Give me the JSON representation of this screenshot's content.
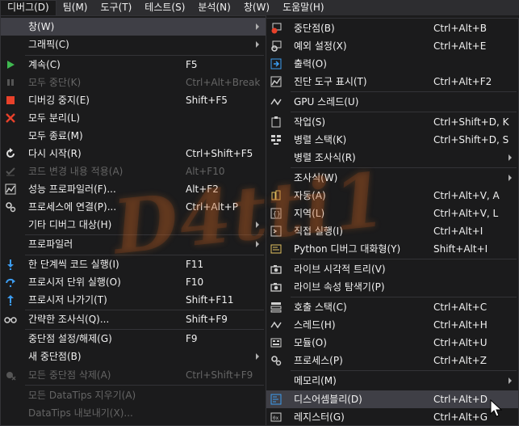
{
  "menubar": {
    "items": [
      {
        "label": "디버그(D)",
        "active": true
      },
      {
        "label": "팀(M)"
      },
      {
        "label": "도구(T)"
      },
      {
        "label": "테스트(S)"
      },
      {
        "label": "분석(N)"
      },
      {
        "label": "창(W)"
      },
      {
        "label": "도움말(H)"
      }
    ]
  },
  "debug_menu": {
    "items": [
      {
        "label": "창(W)",
        "submenu": true,
        "icon": "",
        "highlighted": true
      },
      {
        "label": "그래픽(C)",
        "submenu": true,
        "icon": ""
      },
      {
        "label": "계속(C)",
        "shortcut": "F5",
        "icon": "play-icon"
      },
      {
        "label": "모두 중단(K)",
        "shortcut": "Ctrl+Alt+Break",
        "icon": "pause-icon",
        "disabled": true
      },
      {
        "label": "디버깅 중지(E)",
        "shortcut": "Shift+F5",
        "icon": "stop-icon"
      },
      {
        "label": "모두 분리(L)",
        "icon": "detach-icon"
      },
      {
        "label": "모두 종료(M)",
        "icon": ""
      },
      {
        "label": "다시 시작(R)",
        "shortcut": "Ctrl+Shift+F5",
        "icon": "restart-icon"
      },
      {
        "label": "코드 변경 내용 적용(A)",
        "shortcut": "Alt+F10",
        "icon": "apply-changes-icon",
        "disabled": true
      },
      {
        "label": "성능 프로파일러(F)...",
        "shortcut": "Alt+F2",
        "icon": "profiler-icon"
      },
      {
        "label": "프로세스에 연결(P)...",
        "shortcut": "Ctrl+Alt+P",
        "icon": "attach-icon"
      },
      {
        "label": "기타 디버그 대상(H)",
        "submenu": true,
        "icon": ""
      },
      {
        "label": "프로파일러",
        "submenu": true,
        "icon": ""
      },
      {
        "label": "한 단계씩 코드 실행(I)",
        "shortcut": "F11",
        "icon": "step-into-icon"
      },
      {
        "label": "프로시저 단위 실행(O)",
        "shortcut": "F10",
        "icon": "step-over-icon"
      },
      {
        "label": "프로시저 나가기(T)",
        "shortcut": "Shift+F11",
        "icon": "step-out-icon"
      },
      {
        "label": "간략한 조사식(Q)...",
        "shortcut": "Shift+F9",
        "icon": "quickwatch-icon"
      },
      {
        "label": "중단점 설정/해제(G)",
        "shortcut": "F9",
        "icon": ""
      },
      {
        "label": "새 중단점(B)",
        "submenu": true,
        "icon": ""
      },
      {
        "label": "모든 중단점 삭제(A)",
        "shortcut": "Ctrl+Shift+F9",
        "icon": "delete-breakpoints-icon",
        "disabled": true
      },
      {
        "label": "모든 DataTips 지우기(A)",
        "icon": "",
        "disabled": true
      },
      {
        "label": "DataTips 내보내기(X)...",
        "icon": "",
        "disabled": true
      }
    ]
  },
  "window_submenu": {
    "items": [
      {
        "label": "중단점(B)",
        "shortcut": "Ctrl+Alt+B",
        "icon": "breakpoints-icon"
      },
      {
        "label": "예외 설정(X)",
        "shortcut": "Ctrl+Alt+E",
        "icon": "exception-settings-icon"
      },
      {
        "label": "출력(O)",
        "icon": "output-icon"
      },
      {
        "label": "진단 도구 표시(T)",
        "shortcut": "Ctrl+Alt+F2",
        "icon": "diagnostic-tools-icon"
      },
      {
        "label": "GPU 스레드(U)",
        "icon": "gpu-threads-icon"
      },
      {
        "label": "작업(S)",
        "shortcut": "Ctrl+Shift+D, K",
        "icon": "tasks-icon"
      },
      {
        "label": "병렬 스택(K)",
        "shortcut": "Ctrl+Shift+D, S",
        "icon": "parallel-stacks-icon"
      },
      {
        "label": "병렬 조사식(R)",
        "submenu": true,
        "icon": ""
      },
      {
        "label": "조사식(W)",
        "submenu": true,
        "icon": ""
      },
      {
        "label": "자동(A)",
        "shortcut": "Ctrl+Alt+V, A",
        "icon": "autos-icon"
      },
      {
        "label": "지역(L)",
        "shortcut": "Ctrl+Alt+V, L",
        "icon": "locals-icon"
      },
      {
        "label": "직접 실행(I)",
        "shortcut": "Ctrl+Alt+I",
        "icon": "immediate-icon"
      },
      {
        "label": "Python 디버그 대화형(Y)",
        "shortcut": "Shift+Alt+I",
        "icon": "python-interactive-icon"
      },
      {
        "label": "라이브 시각적 트리(V)",
        "icon": "camera-icon"
      },
      {
        "label": "라이브 속성 탐색기(P)",
        "icon": "camera-icon"
      },
      {
        "label": "호출 스택(C)",
        "shortcut": "Ctrl+Alt+C",
        "icon": "call-stack-icon"
      },
      {
        "label": "스레드(H)",
        "shortcut": "Ctrl+Alt+H",
        "icon": "threads-icon"
      },
      {
        "label": "모듈(O)",
        "shortcut": "Ctrl+Alt+U",
        "icon": "modules-icon"
      },
      {
        "label": "프로세스(P)",
        "shortcut": "Ctrl+Alt+Z",
        "icon": "processes-icon"
      },
      {
        "label": "메모리(M)",
        "submenu": true,
        "icon": ""
      },
      {
        "label": "디스어셈블리(D)",
        "shortcut": "Ctrl+Alt+D",
        "icon": "disassembly-icon",
        "highlighted": true
      },
      {
        "label": "레지스터(G)",
        "shortcut": "Ctrl+Alt+G",
        "icon": "registers-icon"
      }
    ]
  },
  "watermark": {
    "text": "D4tti1"
  },
  "colors": {
    "accent_play": "#3fb950",
    "accent_stop": "#e8412a",
    "accent_blue": "#3c9cf0",
    "disabled_text": "#656565"
  }
}
